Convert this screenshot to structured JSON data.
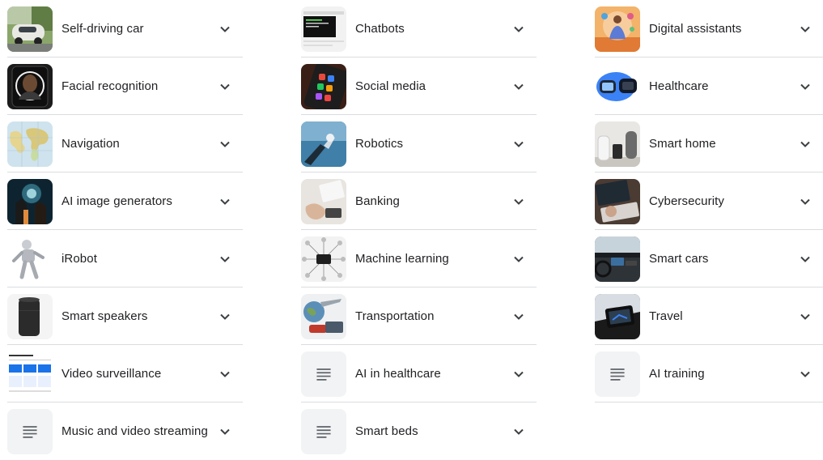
{
  "columns": [
    {
      "items": [
        {
          "label": "Self-driving car",
          "icon": "self-driving-car-photo"
        },
        {
          "label": "Facial recognition",
          "icon": "facial-recognition-photo"
        },
        {
          "label": "Navigation",
          "icon": "world-map-photo"
        },
        {
          "label": "AI image generators",
          "icon": "ai-art-photo"
        },
        {
          "label": "iRobot",
          "icon": "robot-figure-photo"
        },
        {
          "label": "Smart speakers",
          "icon": "smart-speaker-photo"
        },
        {
          "label": "Video surveillance",
          "icon": "surveillance-dashboard-photo"
        },
        {
          "label": "Music and video streaming",
          "icon": "document-lines-icon"
        }
      ]
    },
    {
      "items": [
        {
          "label": "Chatbots",
          "icon": "chatbot-screen-photo"
        },
        {
          "label": "Social media",
          "icon": "phone-apps-photo"
        },
        {
          "label": "Robotics",
          "icon": "robot-hand-photo"
        },
        {
          "label": "Banking",
          "icon": "banking-photo"
        },
        {
          "label": "Machine learning",
          "icon": "network-diagram-photo"
        },
        {
          "label": "Transportation",
          "icon": "transportation-photo"
        },
        {
          "label": "AI in healthcare",
          "icon": "document-lines-icon"
        },
        {
          "label": "Smart beds",
          "icon": "document-lines-icon"
        }
      ]
    },
    {
      "items": [
        {
          "label": "Digital assistants",
          "icon": "digital-assistant-photo"
        },
        {
          "label": "Healthcare",
          "icon": "fitness-tracker-photo"
        },
        {
          "label": "Smart home",
          "icon": "smart-home-devices-photo"
        },
        {
          "label": "Cybersecurity",
          "icon": "laptop-keyboard-photo"
        },
        {
          "label": "Smart cars",
          "icon": "car-dashboard-photo"
        },
        {
          "label": "Travel",
          "icon": "car-navigation-photo"
        },
        {
          "label": "AI training",
          "icon": "document-lines-icon"
        }
      ]
    }
  ]
}
